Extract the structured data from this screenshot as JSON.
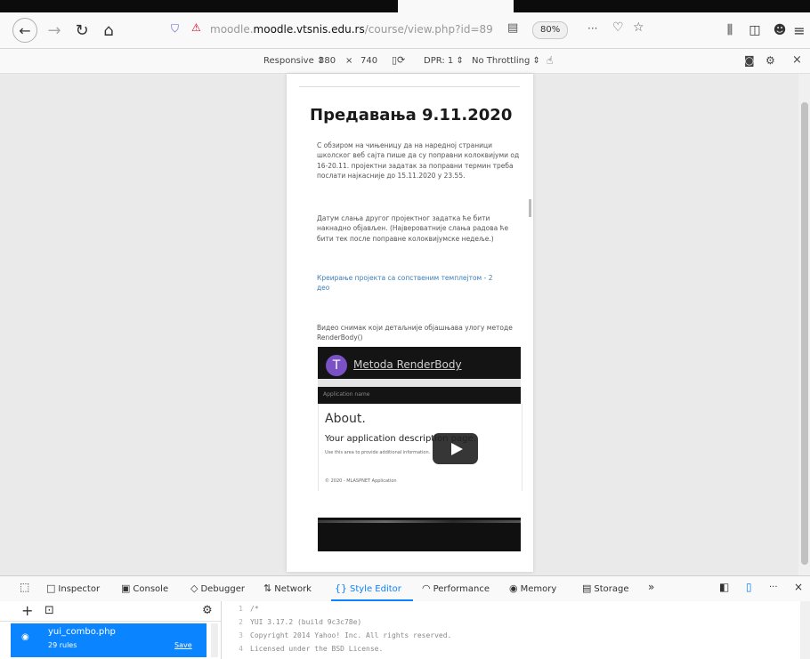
{
  "browser": {
    "url_domain": "moodle.vtsnis.edu.rs",
    "url_path": "/course/view.php?id=89",
    "url_prefix": "moodle.",
    "zoom": "80%",
    "overflow_icon": "···",
    "pocket_icon": "pocket-icon",
    "star_icon": "star-icon"
  },
  "rdm": {
    "device": "Responsive ⇕",
    "width": "380",
    "x": "×",
    "height": "740",
    "dpr": "DPR: 1 ⇕",
    "throttling": "No Throttling ⇕"
  },
  "page": {
    "title": "Предавања 9.11.2020",
    "para1": "С обзиром на чињеницу да на наредној страници школског веб сајта пише да су поправни колоквијуми од 16-20.11. пројектни задатак за поправни термин треба послати најкасније до 15.11.2020 у 23.55.",
    "para2": "Датум слања другог пројектног задатка ће бити накнадно објављен. (Највероватније слања радова ће бити тек после поправне колоквијумске недеље.)",
    "link": "Креирање пројекта са сопственим темплејтом - 2 део",
    "para3": "Видео снимак који детаљније објашњава улогу методе RenderBody()",
    "video": {
      "avatar_letter": "T",
      "title": "Metoda RenderBody",
      "sub": "Application name",
      "about_title": "About.",
      "about_desc": "Your application description page.",
      "about_small": "Use this area to provide additional information.",
      "copyright": "© 2020 - MLASPNET Application"
    }
  },
  "devtools": {
    "tabs": [
      {
        "label": "Inspector",
        "icon": "□"
      },
      {
        "label": "Console",
        "icon": "▣"
      },
      {
        "label": "Debugger",
        "icon": "◇"
      },
      {
        "label": "Network",
        "icon": "⇅"
      },
      {
        "label": "Style Editor",
        "icon": "{}"
      },
      {
        "label": "Performance",
        "icon": "◠"
      },
      {
        "label": "Memory",
        "icon": "◉"
      },
      {
        "label": "Storage",
        "icon": "▤"
      }
    ],
    "more": "»",
    "overflow": "···",
    "close": "×",
    "style_editor": {
      "file_name": "yui_combo.php",
      "rules": "29 rules",
      "save": "Save",
      "code_lines": [
        {
          "n": "1",
          "text": "/*"
        },
        {
          "n": "2",
          "text": "YUI 3.17.2 (build 9c3c78e)"
        },
        {
          "n": "3",
          "text": "Copyright 2014 Yahoo! Inc. All rights reserved."
        },
        {
          "n": "4",
          "text": "Licensed under the BSD License."
        }
      ]
    }
  }
}
